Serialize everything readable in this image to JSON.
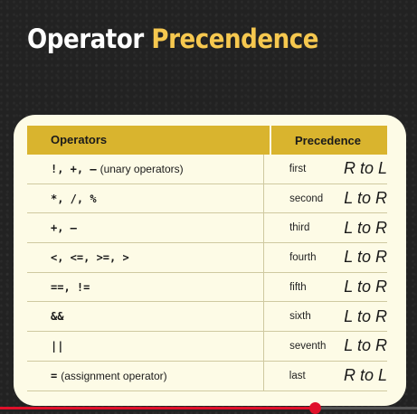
{
  "title": {
    "word1": "Operator",
    "word2": "Precendence"
  },
  "table": {
    "headers": {
      "operators": "Operators",
      "precedence": "Precedence"
    },
    "rows": [
      {
        "op": "!, +, –",
        "note": "(unary operators)",
        "rank": "first",
        "dir": "R to L"
      },
      {
        "op": "*, /, %",
        "note": "",
        "rank": "second",
        "dir": "L to R"
      },
      {
        "op": "+, –",
        "note": "",
        "rank": "third",
        "dir": "L to R"
      },
      {
        "op": "<, <=, >=, >",
        "note": "",
        "rank": "fourth",
        "dir": "L to R"
      },
      {
        "op": "==, !=",
        "note": "",
        "rank": "fifth",
        "dir": "L to R"
      },
      {
        "op": "&&",
        "note": "",
        "rank": "sixth",
        "dir": "L to R"
      },
      {
        "op": "||",
        "note": "",
        "rank": "seventh",
        "dir": "L to R"
      },
      {
        "op": "=",
        "note": "(assignment operator)",
        "rank": "last",
        "dir": "R to L"
      }
    ]
  },
  "video": {
    "progress_fraction": 0.755
  },
  "colors": {
    "accent": "#f6c84f",
    "header": "#d9b42e",
    "card": "#fdfbe6",
    "progress": "#e0102a"
  }
}
